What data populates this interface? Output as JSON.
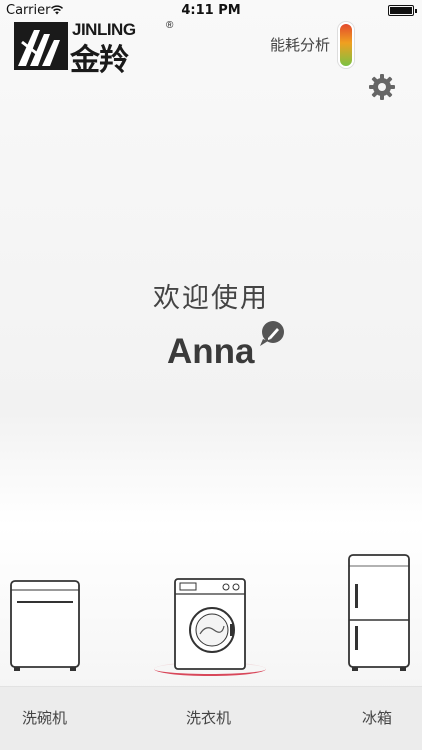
{
  "status_bar": {
    "carrier": "Carrier",
    "time": "4:11 PM"
  },
  "logo": {
    "brand_en": "JINLING",
    "brand_cn": "金羚",
    "registered": "®"
  },
  "energy": {
    "label": "能耗分析",
    "meter_colors": [
      "#e34a2d",
      "#f0a020",
      "#7cc243"
    ]
  },
  "icons": {
    "settings": "gear-icon",
    "edit": "edit-bubble-icon"
  },
  "welcome": {
    "greeting": "欢迎使用",
    "user_name": "Anna"
  },
  "appliances": [
    {
      "name": "dishwasher",
      "icon": "dishwasher-icon"
    },
    {
      "name": "washing-machine",
      "icon": "washing-machine-icon",
      "selected": true
    },
    {
      "name": "refrigerator",
      "icon": "fridge-icon"
    }
  ],
  "tabs": [
    {
      "label": "洗碗机"
    },
    {
      "label": "洗衣机"
    },
    {
      "label": "冰箱"
    }
  ],
  "colors": {
    "selected_ring": "#d8475a",
    "text": "#444444"
  }
}
